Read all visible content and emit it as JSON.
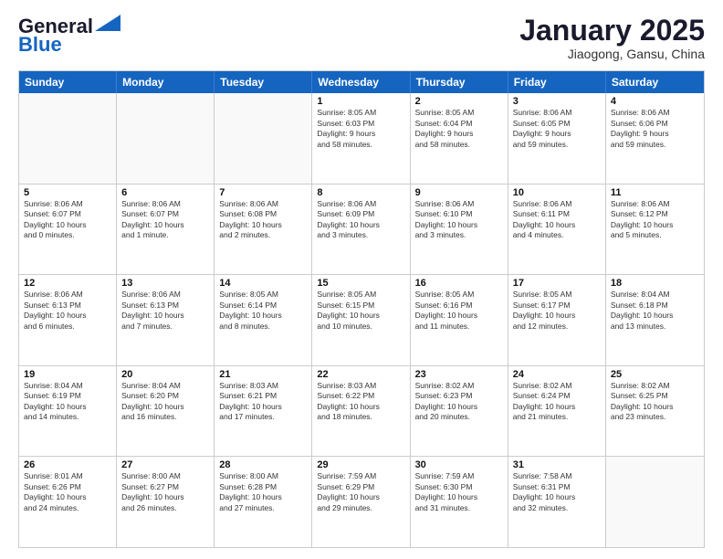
{
  "header": {
    "logo_line1": "General",
    "logo_line2": "Blue",
    "month": "January 2025",
    "location": "Jiaogong, Gansu, China"
  },
  "weekdays": [
    "Sunday",
    "Monday",
    "Tuesday",
    "Wednesday",
    "Thursday",
    "Friday",
    "Saturday"
  ],
  "rows": [
    [
      {
        "day": "",
        "text": "",
        "empty": true
      },
      {
        "day": "",
        "text": "",
        "empty": true
      },
      {
        "day": "",
        "text": "",
        "empty": true
      },
      {
        "day": "1",
        "text": "Sunrise: 8:05 AM\nSunset: 6:03 PM\nDaylight: 9 hours\nand 58 minutes."
      },
      {
        "day": "2",
        "text": "Sunrise: 8:05 AM\nSunset: 6:04 PM\nDaylight: 9 hours\nand 58 minutes."
      },
      {
        "day": "3",
        "text": "Sunrise: 8:06 AM\nSunset: 6:05 PM\nDaylight: 9 hours\nand 59 minutes."
      },
      {
        "day": "4",
        "text": "Sunrise: 8:06 AM\nSunset: 6:06 PM\nDaylight: 9 hours\nand 59 minutes."
      }
    ],
    [
      {
        "day": "5",
        "text": "Sunrise: 8:06 AM\nSunset: 6:07 PM\nDaylight: 10 hours\nand 0 minutes."
      },
      {
        "day": "6",
        "text": "Sunrise: 8:06 AM\nSunset: 6:07 PM\nDaylight: 10 hours\nand 1 minute."
      },
      {
        "day": "7",
        "text": "Sunrise: 8:06 AM\nSunset: 6:08 PM\nDaylight: 10 hours\nand 2 minutes."
      },
      {
        "day": "8",
        "text": "Sunrise: 8:06 AM\nSunset: 6:09 PM\nDaylight: 10 hours\nand 3 minutes."
      },
      {
        "day": "9",
        "text": "Sunrise: 8:06 AM\nSunset: 6:10 PM\nDaylight: 10 hours\nand 3 minutes."
      },
      {
        "day": "10",
        "text": "Sunrise: 8:06 AM\nSunset: 6:11 PM\nDaylight: 10 hours\nand 4 minutes."
      },
      {
        "day": "11",
        "text": "Sunrise: 8:06 AM\nSunset: 6:12 PM\nDaylight: 10 hours\nand 5 minutes."
      }
    ],
    [
      {
        "day": "12",
        "text": "Sunrise: 8:06 AM\nSunset: 6:13 PM\nDaylight: 10 hours\nand 6 minutes."
      },
      {
        "day": "13",
        "text": "Sunrise: 8:06 AM\nSunset: 6:13 PM\nDaylight: 10 hours\nand 7 minutes."
      },
      {
        "day": "14",
        "text": "Sunrise: 8:05 AM\nSunset: 6:14 PM\nDaylight: 10 hours\nand 8 minutes."
      },
      {
        "day": "15",
        "text": "Sunrise: 8:05 AM\nSunset: 6:15 PM\nDaylight: 10 hours\nand 10 minutes."
      },
      {
        "day": "16",
        "text": "Sunrise: 8:05 AM\nSunset: 6:16 PM\nDaylight: 10 hours\nand 11 minutes."
      },
      {
        "day": "17",
        "text": "Sunrise: 8:05 AM\nSunset: 6:17 PM\nDaylight: 10 hours\nand 12 minutes."
      },
      {
        "day": "18",
        "text": "Sunrise: 8:04 AM\nSunset: 6:18 PM\nDaylight: 10 hours\nand 13 minutes."
      }
    ],
    [
      {
        "day": "19",
        "text": "Sunrise: 8:04 AM\nSunset: 6:19 PM\nDaylight: 10 hours\nand 14 minutes."
      },
      {
        "day": "20",
        "text": "Sunrise: 8:04 AM\nSunset: 6:20 PM\nDaylight: 10 hours\nand 16 minutes."
      },
      {
        "day": "21",
        "text": "Sunrise: 8:03 AM\nSunset: 6:21 PM\nDaylight: 10 hours\nand 17 minutes."
      },
      {
        "day": "22",
        "text": "Sunrise: 8:03 AM\nSunset: 6:22 PM\nDaylight: 10 hours\nand 18 minutes."
      },
      {
        "day": "23",
        "text": "Sunrise: 8:02 AM\nSunset: 6:23 PM\nDaylight: 10 hours\nand 20 minutes."
      },
      {
        "day": "24",
        "text": "Sunrise: 8:02 AM\nSunset: 6:24 PM\nDaylight: 10 hours\nand 21 minutes."
      },
      {
        "day": "25",
        "text": "Sunrise: 8:02 AM\nSunset: 6:25 PM\nDaylight: 10 hours\nand 23 minutes."
      }
    ],
    [
      {
        "day": "26",
        "text": "Sunrise: 8:01 AM\nSunset: 6:26 PM\nDaylight: 10 hours\nand 24 minutes."
      },
      {
        "day": "27",
        "text": "Sunrise: 8:00 AM\nSunset: 6:27 PM\nDaylight: 10 hours\nand 26 minutes."
      },
      {
        "day": "28",
        "text": "Sunrise: 8:00 AM\nSunset: 6:28 PM\nDaylight: 10 hours\nand 27 minutes."
      },
      {
        "day": "29",
        "text": "Sunrise: 7:59 AM\nSunset: 6:29 PM\nDaylight: 10 hours\nand 29 minutes."
      },
      {
        "day": "30",
        "text": "Sunrise: 7:59 AM\nSunset: 6:30 PM\nDaylight: 10 hours\nand 31 minutes."
      },
      {
        "day": "31",
        "text": "Sunrise: 7:58 AM\nSunset: 6:31 PM\nDaylight: 10 hours\nand 32 minutes."
      },
      {
        "day": "",
        "text": "",
        "empty": true
      }
    ]
  ]
}
